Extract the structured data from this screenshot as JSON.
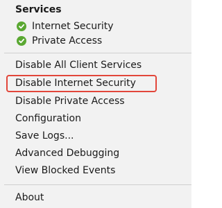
{
  "menu": {
    "section_title": "Services",
    "statuses": [
      {
        "label": "Internet Security",
        "icon": "check-circle-icon",
        "color": "#5aa832"
      },
      {
        "label": "Private Access",
        "icon": "check-circle-icon",
        "color": "#5aa832"
      }
    ],
    "items": [
      {
        "label": "Disable All Client Services"
      },
      {
        "label": "Disable Internet Security",
        "highlighted": true
      },
      {
        "label": "Disable Private Access"
      },
      {
        "label": "Configuration"
      },
      {
        "label": "Save Logs..."
      },
      {
        "label": "Advanced Debugging"
      },
      {
        "label": "View Blocked Events"
      }
    ],
    "footer_items": [
      {
        "label": "About"
      }
    ],
    "highlight_color": "#e2463a"
  }
}
